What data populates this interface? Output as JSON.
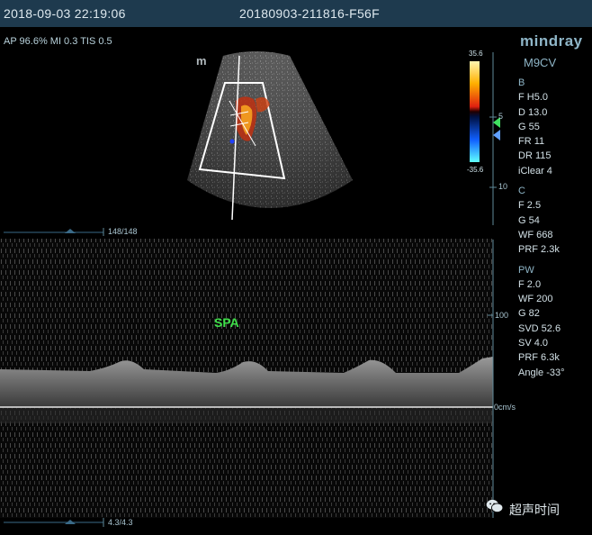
{
  "header": {
    "datetime": "2018-09-03 22:19:06",
    "study_id": "20180903-211816-F56F"
  },
  "acoustic": "AP 96.6%  MI 0.3  TIS 0.5",
  "brand": {
    "logo": "mindray",
    "model": "M9CV"
  },
  "colorbar": {
    "top": "35.6",
    "bottom": "-35.6"
  },
  "params": {
    "b_header": "B",
    "b": [
      "F H5.0",
      "D 13.0",
      "G 55",
      "FR 11",
      "DR 115",
      "iClear 4"
    ],
    "c_header": "C",
    "c": [
      "F 2.5",
      "G 54",
      "WF 668",
      "PRF 2.3k"
    ],
    "pw_header": "PW",
    "pw": [
      "F 2.0",
      "WF 200",
      "G 82",
      "SVD 52.6",
      "SV 4.0",
      "PRF 6.3k",
      "Angle -33°"
    ]
  },
  "scales": {
    "depth_ticks": [
      "5",
      "10"
    ],
    "velocity_tick": "100",
    "baseline_label": "0cm/s"
  },
  "timeline": {
    "top_label": "148/148",
    "bottom_label": "4.3/4.3"
  },
  "annotation": "SPA",
  "probe_marker": "m",
  "watermark": {
    "text": "超声时间",
    "icon": "wechat-icon"
  }
}
